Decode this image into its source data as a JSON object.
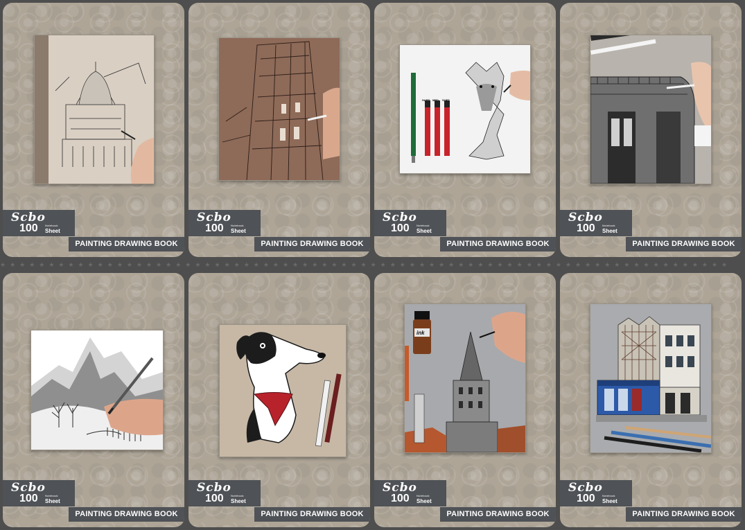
{
  "books": [
    {
      "brand": "Scbo",
      "count": "100",
      "kind_label": "Notebook",
      "sheet_label": "Sheet",
      "title": "PAINTING DRAWING BOOK",
      "illustration": "domed-building-sketch"
    },
    {
      "brand": "Scbo",
      "count": "100",
      "kind_label": "Notebook",
      "sheet_label": "Sheet",
      "title": "PAINTING DRAWING BOOK",
      "illustration": "building-facade-brown-paper"
    },
    {
      "brand": "Scbo",
      "count": "100",
      "kind_label": "Notebook",
      "sheet_label": "Sheet",
      "title": "PAINTING DRAWING BOOK",
      "illustration": "wolf-drawing-with-pencil-leads",
      "lead_labels": [
        "HARD",
        "MED",
        "SOFT"
      ]
    },
    {
      "brand": "Scbo",
      "count": "100",
      "kind_label": "Notebook",
      "sheet_label": "Sheet",
      "title": "PAINTING DRAWING BOOK",
      "illustration": "ornate-building-corner"
    },
    {
      "brand": "Scbo",
      "count": "100",
      "kind_label": "Notebook",
      "sheet_label": "Sheet",
      "title": "PAINTING DRAWING BOOK",
      "illustration": "mountain-landscape-sketch"
    },
    {
      "brand": "Scbo",
      "count": "100",
      "kind_label": "Notebook",
      "sheet_label": "Sheet",
      "title": "PAINTING DRAWING BOOK",
      "illustration": "cartoon-dog-with-bandana"
    },
    {
      "brand": "Scbo",
      "count": "100",
      "kind_label": "Notebook",
      "sheet_label": "Sheet",
      "title": "PAINTING DRAWING BOOK",
      "illustration": "tower-ink-drawing",
      "ink_bottle_label": "ink"
    },
    {
      "brand": "Scbo",
      "count": "100",
      "kind_label": "Notebook",
      "sheet_label": "Sheet",
      "title": "PAINTING DRAWING BOOK",
      "illustration": "street-shopfront-drawing"
    }
  ],
  "colors": {
    "background": "#4e4e4e",
    "cover": "#aea597",
    "label_band": "#4f5256",
    "label_text": "#ffffff"
  }
}
